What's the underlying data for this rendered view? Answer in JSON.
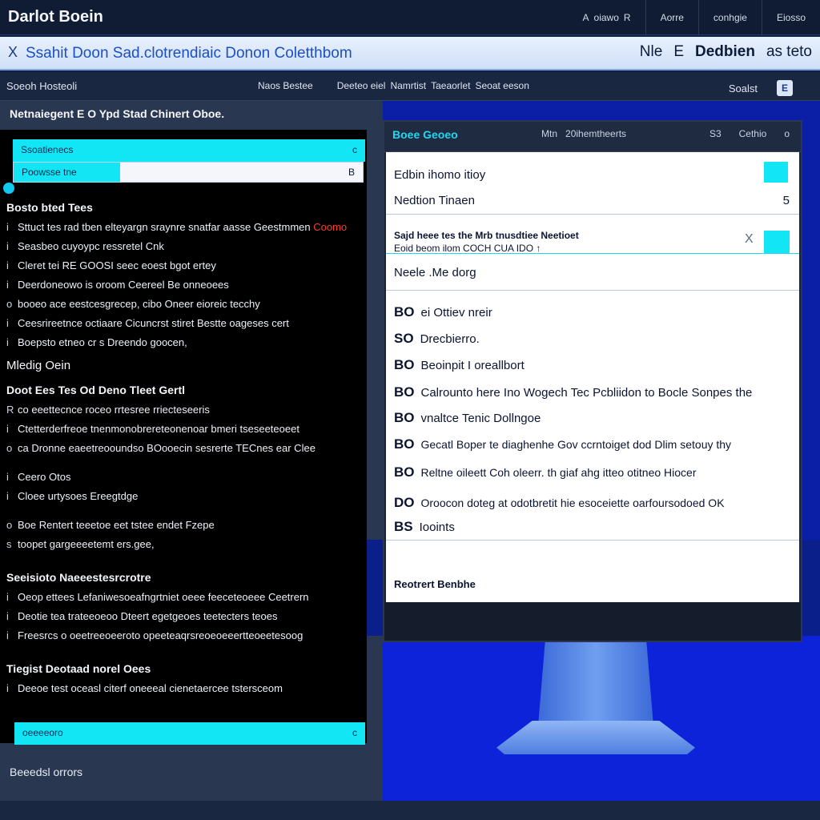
{
  "app": {
    "title": "Darlot Boein",
    "menu": [
      {
        "label": "oiawo",
        "prefix": "A",
        "suffix": "R"
      },
      {
        "label": "Aorre"
      },
      {
        "label": "conhgie"
      },
      {
        "label": "Eiosso"
      }
    ]
  },
  "tab": {
    "close_glyph": "X",
    "title": "Ssahit Doon Sad.clotrendiaic Donon Coletthbom",
    "right_items": [
      "Nle",
      "E",
      "Dedbien",
      "as teto"
    ]
  },
  "toolbar": {
    "left": "Soeoh Hosteoli",
    "mid": [
      "Naos Bestee",
      "Deeteo eiel",
      "Namrtist",
      "Taeaorlet",
      "Seoat eeson"
    ],
    "right": "Soalst",
    "icon_glyph": "E"
  },
  "left_panel": {
    "heading": "Netnaiegent E O Ypd Stad Chinert Oboe.",
    "cyan_bar_top": {
      "label": "Ssoatienecs",
      "glyph": "c"
    },
    "search": {
      "prefix": "Poowsse tne",
      "value": "",
      "suffix": "B"
    },
    "section1_title": "Bosto bted Tees",
    "rows1": [
      {
        "glyph": "i",
        "text": "Sttuct tes rad tben elteyargn sraynre snatfar aasse Geestmmen",
        "accent": "Coomo"
      },
      {
        "glyph": "i",
        "text": "Seasbeo cuyoypc ressretel Cnk"
      },
      {
        "glyph": "i",
        "text": "Cleret tei RE GOOSI seec eoest bgot ertey"
      },
      {
        "glyph": "i",
        "text": "Deerdoneowo is oroom Ceereel Be onneoees"
      },
      {
        "glyph": "o",
        "text": "booeo ace eestcesgrecep, cibo Oneer eioreic tecchy"
      },
      {
        "glyph": "i",
        "text": "Ceesrireetnce octiaare Cicuncrst stiret Bestte oageses cert"
      },
      {
        "glyph": "i",
        "text": "Boepsto etneo cr s Dreendo goocen,"
      }
    ],
    "section2_title": "Mledig Oein",
    "section3_title": "Doot Ees Tes Od Deno Tleet Gertl",
    "rows2": [
      {
        "glyph": "R",
        "text": "co eeettecnce roceo rrtesree rriecteseeris"
      },
      {
        "glyph": "i",
        "text": "Ctetterderfreoe tnenmonobrereteonenoar bmeri tseseeteoeet"
      },
      {
        "glyph": "o",
        "text": "ca Dronne eaeetreooundso BOooecin sesrerte TECnes ear Clee"
      }
    ],
    "rows3": [
      {
        "glyph": "i",
        "text": "Ceero Otos"
      },
      {
        "glyph": "i",
        "text": "Cloee urtysoes Ereegtdge"
      }
    ],
    "rows4": [
      {
        "glyph": "o",
        "text": "Boe Rentert teeetoe eet tstee endet Fzepe"
      },
      {
        "glyph": "s",
        "text": "toopet gargeeeetemt ers.gee,"
      }
    ],
    "section4_title": "Seeisioto Naeeestesrcrotre",
    "rows5": [
      {
        "glyph": "i",
        "text": "Oeop ettees Lefaniwesoeafngrtniet oeee feeceteoeee Ceetrern"
      },
      {
        "glyph": "i",
        "text": "Deotie tea trateeoeoo Dteert egetgeoes teetecters teoes"
      },
      {
        "glyph": "i",
        "text": "Freesrcs o oeetreeoeeroto opeeteaqrsreoeoeeertteoeetesoog"
      }
    ],
    "section5_title": "Tiegist Deotaad norel Oees",
    "rows6": [
      {
        "glyph": "i",
        "text": "Deeoe test oceasl citerf oneeeal cienetaercee tstersceom"
      }
    ],
    "cyan_bar_bottom": {
      "label": "oeeeeoro",
      "glyph": "c"
    },
    "footer": "Beeedsl orrors"
  },
  "window": {
    "title": "Boee Geoeo",
    "tabs": [
      "Mtn",
      "20ihemtheerts"
    ],
    "right": [
      "S3",
      "Cethio",
      "o"
    ],
    "field1": "Edbin ihomo itioy",
    "field2_label": "Nedtion Tinaen",
    "field2_value": "5",
    "note_line1": "Sajd heee tes the Mrb tnusdtiee Neetioet",
    "note_line2": "Eoid beom ilom COCH CUA IDO ↑",
    "note_glyph": "X",
    "section_label": "Neele .Me dorg",
    "items": [
      {
        "tag": "BO",
        "text": "ei Ottiev nreir"
      },
      {
        "tag": "SO",
        "text": "Drecbierro."
      },
      {
        "tag": "BO",
        "text": "Beoinpit I oreallbort"
      },
      {
        "tag": "BO",
        "text": "Calrounto here Ino Wogech Tec Pcbliidon to Bocle Sonpes the"
      },
      {
        "tag": "BO",
        "text": "vnaltce Tenic Dollngoe"
      },
      {
        "tag": "BO",
        "text": "Gecatl Boper te diaghenhe Gov ccrntoiget dod Dlim setouy thy"
      },
      {
        "tag": "BO",
        "text": "Reltne oileett Coh oleerr. th giaf ahg itteo otitneo Hiocer"
      },
      {
        "tag": "DO",
        "text": "Oroocon doteg at odotbretit hie esoceiette oarfoursodoed OK"
      },
      {
        "tag": "BS",
        "text": "Iooints"
      }
    ],
    "footer": "Reotrert Benbhe"
  }
}
